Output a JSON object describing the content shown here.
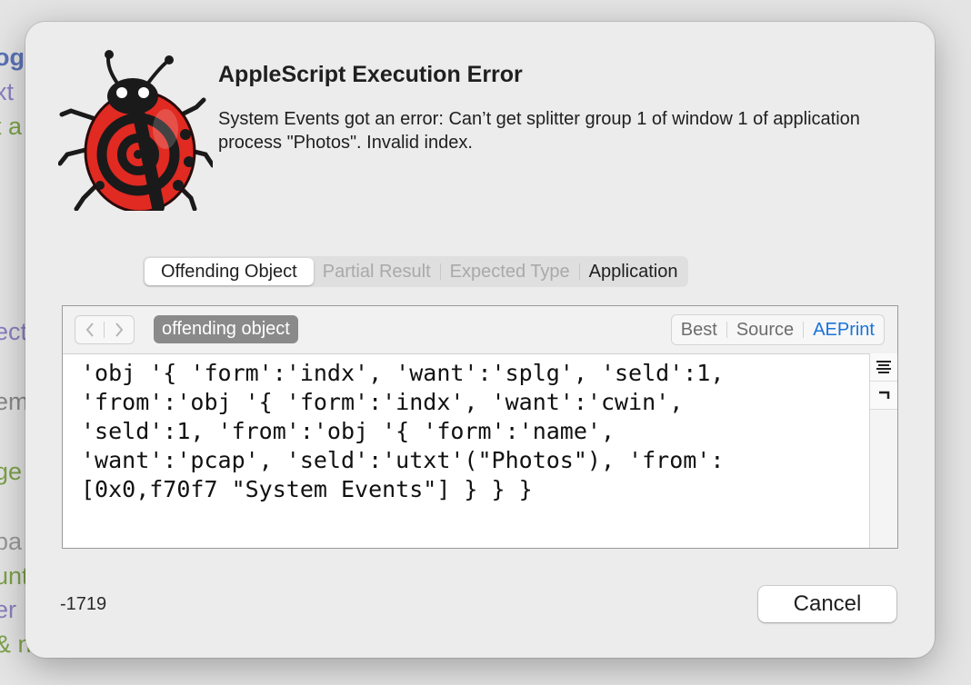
{
  "background": {
    "lines": [
      {
        "text": "og",
        "color": "#5b72b8"
      },
      {
        "text": "xt",
        "color": "#8b7fc0"
      },
      {
        "text": "t a",
        "color": "#7da24a"
      },
      {
        "text": "ect",
        "color": "#8b7fc0"
      },
      {
        "text": "em",
        "color": "#888888"
      },
      {
        "text": "ge",
        "color": "#7da24a"
      },
      {
        "text": "pa",
        "color": "#999999"
      },
      {
        "text": "unt",
        "color": "#7da24a"
      },
      {
        "text": "er",
        "color": "#8b7fc0"
      },
      {
        "text": "& n",
        "color": "#7da24a"
      }
    ]
  },
  "dialog": {
    "icon": "ladybug-icon",
    "title": "AppleScript Execution Error",
    "message": "System Events got an error: Can’t get splitter group 1 of window 1 of application process \"Photos\". Invalid index.",
    "tabs": [
      {
        "label": "Offending Object",
        "state": "active"
      },
      {
        "label": "Partial Result",
        "state": "disabled"
      },
      {
        "label": "Expected Type",
        "state": "disabled"
      },
      {
        "label": "Application",
        "state": "enabled"
      }
    ],
    "panel": {
      "back_icon": "chevron-left-icon",
      "forward_icon": "chevron-right-icon",
      "chip": "offending object",
      "views": [
        {
          "label": "Best",
          "selected": false
        },
        {
          "label": "Source",
          "selected": false
        },
        {
          "label": "AEPrint",
          "selected": true
        }
      ],
      "code": "'obj '{ 'form':'indx', 'want':'splg', 'seld':1,\n'from':'obj '{ 'form':'indx', 'want':'cwin',\n'seld':1, 'from':'obj '{ 'form':'name',\n'want':'pcap', 'seld':'utxt'(\"Photos\"), 'from':\n[0x0,f70f7 \"System Events\"] } } }",
      "side_buttons": [
        "wrap-lines-icon",
        "return-icon"
      ]
    },
    "error_code": "-1719",
    "cancel_label": "Cancel"
  },
  "colors": {
    "accent": "#1a73d9",
    "chip": "#8a8a8a",
    "ladybug_red": "#e02a22"
  }
}
